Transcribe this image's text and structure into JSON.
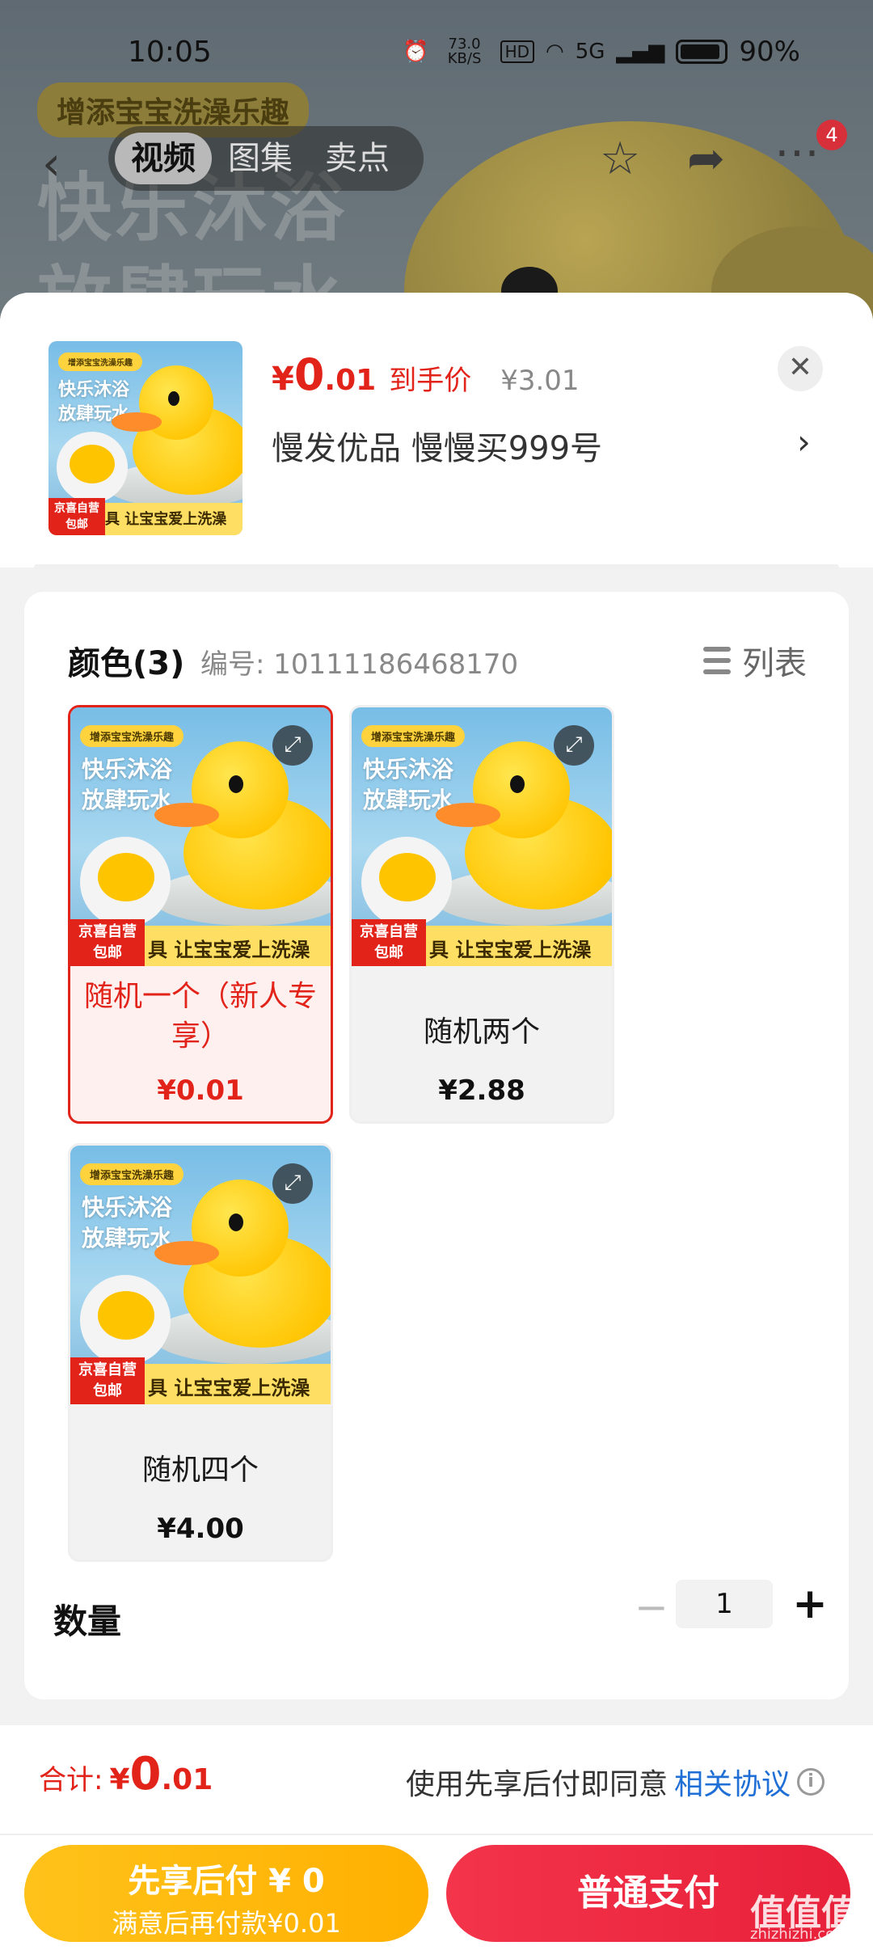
{
  "status_bar": {
    "time": "10:05",
    "net_speed": "73.0 KB/S",
    "hd": "HD",
    "signal": "5G",
    "battery": "90%"
  },
  "background": {
    "promo_tag": "增添宝宝洗澡乐趣",
    "headline": "快乐沐浴放肆玩水",
    "tabs": [
      "视频",
      "图集",
      "卖点"
    ],
    "active_tab": "视频",
    "more_badge": "4"
  },
  "header": {
    "price_yen": "¥",
    "price_int": "0",
    "price_dec": ".01",
    "price_label": "到手价",
    "original_price": "¥3.01",
    "shop_info": "慢发优品  慢慢买999号"
  },
  "artwork": {
    "top_tag": "增添宝宝洗澡乐趣",
    "title_line1": "快乐沐浴",
    "title_line2": "放肆玩水",
    "badge_line1": "京喜自营",
    "badge_line2": "包邮",
    "banner": "具 让宝宝爱上洗澡"
  },
  "spec": {
    "title": "颜色(3)",
    "code": "编号: 10111186468170",
    "list_label": "列表",
    "options": [
      {
        "name": "随机一个（新人专享）",
        "price": "¥0.01",
        "selected": true
      },
      {
        "name": "随机两个",
        "price": "¥2.88",
        "selected": false
      },
      {
        "name": "随机四个",
        "price": "¥4.00",
        "selected": false
      }
    ]
  },
  "quantity": {
    "label": "数量",
    "value": "1",
    "minus": "−",
    "plus": "+"
  },
  "footer": {
    "total_label": "合计:",
    "total_yen": "¥",
    "total_int": "0",
    "total_dec": ".01",
    "agree_text": "使用先享后付即同意",
    "agree_link": "相关协议",
    "bnpl_main": "先享后付 ¥ 0",
    "bnpl_sub": "满意后再付款¥0.01",
    "pay_label": "普通支付"
  },
  "watermark": {
    "main": "值值值",
    "sub": "zhizhizhi.com"
  },
  "colors": {
    "accent_red": "#e2231a",
    "link_blue": "#1f6fd6",
    "bnpl_yellow": "#ffb000",
    "pay_red": "#e8203a"
  }
}
